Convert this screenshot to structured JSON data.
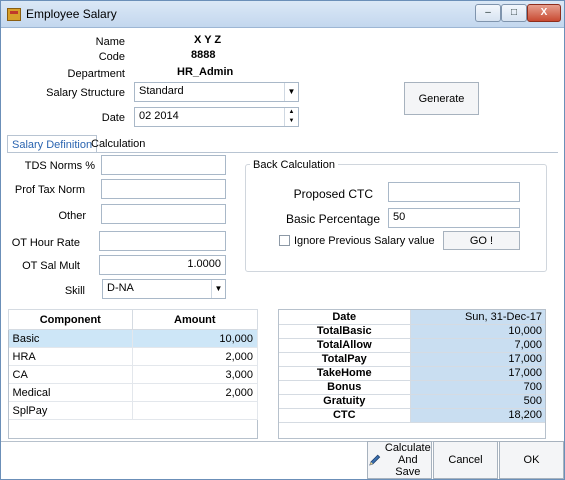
{
  "window": {
    "title": "Employee Salary",
    "controls": {
      "minimize": "–",
      "maximize": "□",
      "close": "X"
    }
  },
  "header": {
    "name_label": "Name",
    "name_value": "X Y Z",
    "code_label": "Code",
    "code_value": "8888",
    "department_label": "Department",
    "department_value": "HR_Admin",
    "salary_structure_label": "Salary Structure",
    "salary_structure_value": "Standard",
    "date_label": "Date",
    "date_value": "02 2014",
    "generate_label": "Generate"
  },
  "tabs": [
    {
      "label": "Salary Definition",
      "active": true
    },
    {
      "label": "Calculation",
      "active": false
    }
  ],
  "salary_definition": {
    "tds_label": "TDS Norms %",
    "tds_value": "",
    "prof_tax_label": "Prof Tax Norm",
    "prof_tax_value": "",
    "other_label": "Other",
    "other_value": "",
    "ot_hour_rate_label": "OT Hour Rate",
    "ot_hour_rate_value": "",
    "ot_sal_mult_label": "OT Sal Mult",
    "ot_sal_mult_value": "1.0000",
    "skill_label": "Skill",
    "skill_value": "D-NA"
  },
  "back_calculation": {
    "title": "Back Calculation",
    "proposed_ctc_label": "Proposed CTC",
    "proposed_ctc_value": "",
    "basic_percentage_label": "Basic Percentage",
    "basic_percentage_value": "50",
    "ignore_prev_label": "Ignore Previous Salary value",
    "ignore_prev_checked": false,
    "go_label": "GO !"
  },
  "components": {
    "headers": [
      "Component",
      "Amount"
    ],
    "rows": [
      {
        "component": "Basic",
        "amount": "10,000"
      },
      {
        "component": "HRA",
        "amount": "2,000"
      },
      {
        "component": "CA",
        "amount": "3,000"
      },
      {
        "component": "Medical",
        "amount": "2,000"
      },
      {
        "component": "SplPay",
        "amount": ""
      }
    ]
  },
  "summary": [
    {
      "key": "Date",
      "value": "Sun, 31-Dec-17"
    },
    {
      "key": "TotalBasic",
      "value": "10,000"
    },
    {
      "key": "TotalAllow",
      "value": "7,000"
    },
    {
      "key": "TotalPay",
      "value": "17,000"
    },
    {
      "key": "TakeHome",
      "value": "17,000"
    },
    {
      "key": "Bonus",
      "value": "700"
    },
    {
      "key": "Gratuity",
      "value": "500"
    },
    {
      "key": "CTC",
      "value": "18,200"
    }
  ],
  "footer": {
    "calculate_save_line1": "Calculate",
    "calculate_save_line2": "And Save",
    "cancel_label": "Cancel",
    "ok_label": "OK"
  },
  "colors": {
    "selected_row": "#cde6f7",
    "summary_value_bg": "#c9def1",
    "active_tab_text": "#2a64b0"
  }
}
